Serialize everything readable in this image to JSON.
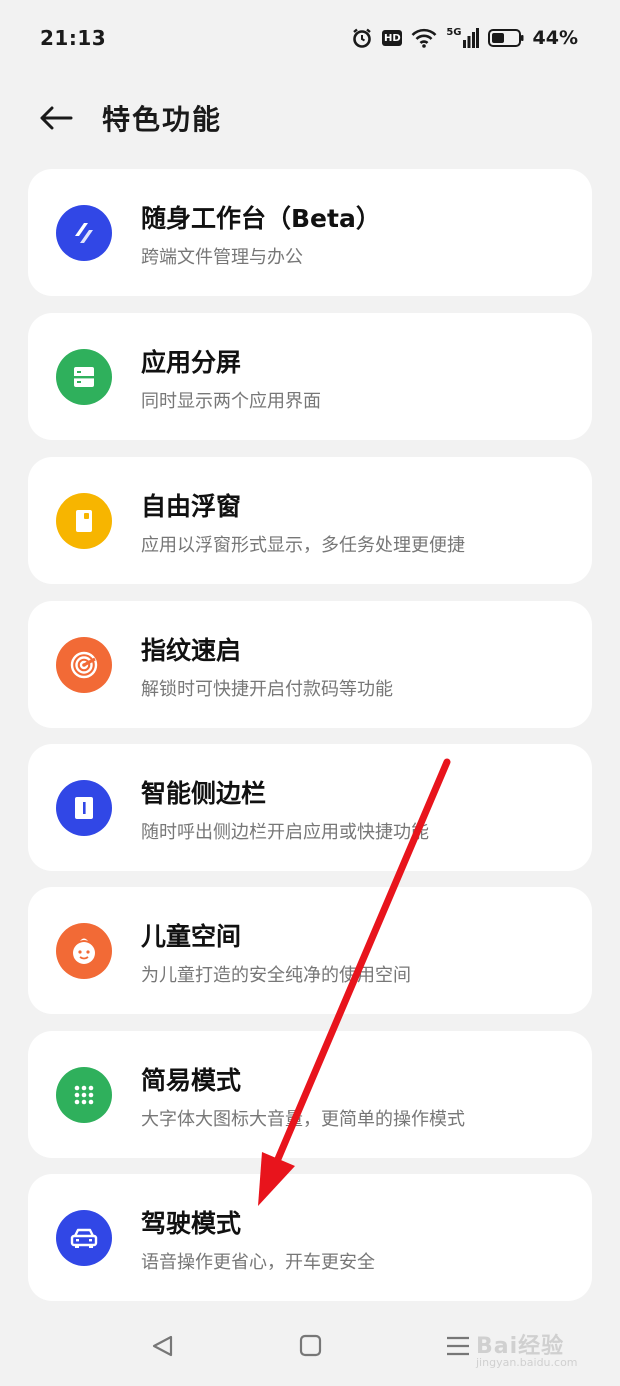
{
  "status_bar": {
    "time": "21:13",
    "hd": "HD",
    "network": "5G",
    "battery": "44%"
  },
  "header": {
    "title": "特色功能"
  },
  "features": [
    {
      "title": "随身工作台（Beta）",
      "subtitle": "跨端文件管理与办公",
      "icon": "workspace-icon",
      "color": "#3147e6"
    },
    {
      "title": "应用分屏",
      "subtitle": "同时显示两个应用界面",
      "icon": "split-screen-icon",
      "color": "#2fb05c"
    },
    {
      "title": "自由浮窗",
      "subtitle": "应用以浮窗形式显示，多任务处理更便捷",
      "icon": "floating-window-icon",
      "color": "#f7b500"
    },
    {
      "title": "指纹速启",
      "subtitle": "解锁时可快捷开启付款码等功能",
      "icon": "fingerprint-icon",
      "color": "#f26a36"
    },
    {
      "title": "智能侧边栏",
      "subtitle": "随时呼出侧边栏开启应用或快捷功能",
      "icon": "sidebar-icon",
      "color": "#3147e6"
    },
    {
      "title": "儿童空间",
      "subtitle": "为儿童打造的安全纯净的使用空间",
      "icon": "kid-space-icon",
      "color": "#f26a36"
    },
    {
      "title": "简易模式",
      "subtitle": "大字体大图标大音量，更简单的操作模式",
      "icon": "simple-mode-icon",
      "color": "#2fb05c"
    },
    {
      "title": "驾驶模式",
      "subtitle": "语音操作更省心，开车更安全",
      "icon": "car-icon",
      "color": "#3147e6"
    }
  ],
  "nav": {
    "back": "back-triangle-icon",
    "home": "home-square-icon",
    "menu": "menu-lines-icon"
  },
  "watermark": {
    "main": "Bai经验",
    "sub": "jingyan.baidu.com"
  },
  "annotation_color": "#e8141c"
}
